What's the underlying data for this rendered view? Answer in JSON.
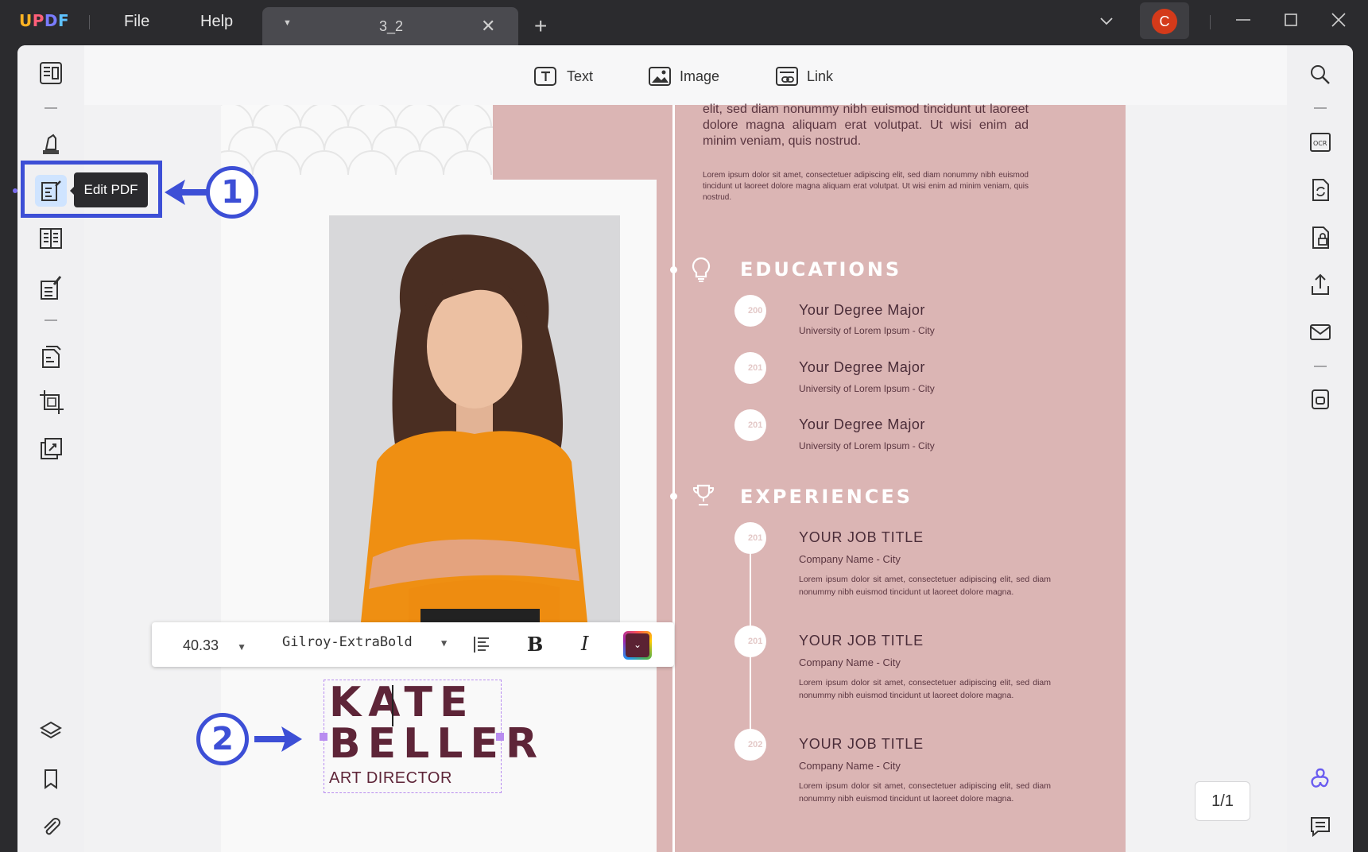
{
  "app": {
    "logo": {
      "u": "U",
      "p": "P",
      "d": "D",
      "f": "F"
    },
    "menu": {
      "file": "File",
      "help": "Help"
    },
    "tab": {
      "title": "3_2",
      "close": "✕",
      "add": "+"
    },
    "user": {
      "avatar_letter": "C"
    }
  },
  "edit_toolbar": {
    "text_label": "Text",
    "image_label": "Image",
    "link_label": "Link"
  },
  "left_sidebar": {
    "tooltip": "Edit PDF",
    "active_item": "edit-pdf"
  },
  "callouts": {
    "one": "1",
    "two": "2"
  },
  "format_toolbar": {
    "font_size": "40.33",
    "font_name": "Gilroy-ExtraBold",
    "bold": "B",
    "italic": "I",
    "color": "#5b2233"
  },
  "resume": {
    "name_line1": "KATE",
    "name_line2": "BELLER",
    "role": "ART DIRECTOR",
    "intro_text": "elit, sed diam nonummy nibh euismod tincidunt ut laoreet dolore magna aliquam erat volutpat. Ut wisi enim ad minim veniam, quis nostrud.",
    "lorem_small": "Lorem ipsum dolor sit amet, consectetuer adipiscing elit, sed diam nonummy nibh euismod tincidunt ut laoreet dolore magna aliquam erat volutpat. Ut wisi enim ad minim veniam, quis nostrud.",
    "educations_title": "EDUCATIONS",
    "educations": [
      {
        "year": "200",
        "title": "Your Degree Major",
        "sub": "University of Lorem Ipsum - City"
      },
      {
        "year": "201",
        "title": "Your Degree Major",
        "sub": "University of Lorem Ipsum - City"
      },
      {
        "year": "201",
        "title": "Your Degree Major",
        "sub": "University of Lorem Ipsum - City"
      }
    ],
    "experiences_title": "EXPERIENCES",
    "experiences": [
      {
        "year": "201",
        "title": "YOUR JOB TITLE",
        "sub": "Company Name - City",
        "body": "Lorem ipsum dolor sit amet, consectetuer adipiscing elit, sed diam nonummy nibh euismod tincidunt ut laoreet dolore magna."
      },
      {
        "year": "201",
        "title": "YOUR JOB TITLE",
        "sub": "Company Name - City",
        "body": "Lorem ipsum dolor sit amet, consectetuer adipiscing elit, sed diam nonummy nibh euismod tincidunt ut laoreet dolore magna."
      },
      {
        "year": "202",
        "title": "YOUR JOB TITLE",
        "sub": "Company Name - City",
        "body": "Lorem ipsum dolor sit amet, consectetuer adipiscing elit, sed diam nonummy nibh euismod tincidunt ut laoreet dolore magna."
      }
    ]
  },
  "page_indicator": "1/1",
  "colors": {
    "accent": "#3d4fd6",
    "resume_pink": "#dbb5b4",
    "name_color": "#5e2538",
    "selection": "#b88cf0"
  }
}
